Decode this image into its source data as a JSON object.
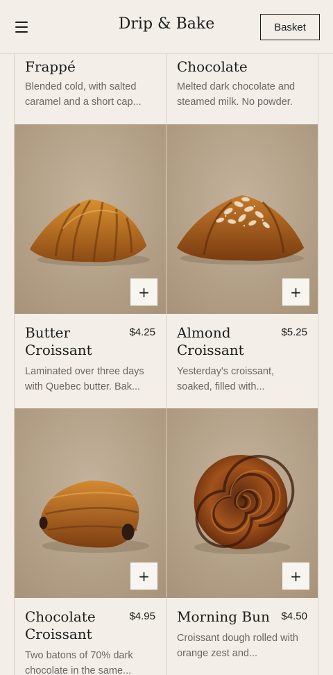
{
  "header": {
    "brand": "Drip & Bake",
    "basket_label": "Basket",
    "menu_icon": "hamburger-menu-icon"
  },
  "products": [
    {
      "name": "Frappé",
      "price": "",
      "description": "Blended cold, with salted caramel and a short cap..."
    },
    {
      "name": "Chocolate",
      "price": "",
      "description": "Melted dark chocolate and steamed milk. No powder."
    },
    {
      "name": "Butter Croissant",
      "price": "$4.25",
      "description": "Laminated over three days with Quebec butter. Bak...",
      "add_label": "+"
    },
    {
      "name": "Almond Croissant",
      "price": "$5.25",
      "description": "Yesterday's croissant, soaked, filled with...",
      "add_label": "+"
    },
    {
      "name": "Chocolate Croissant",
      "price": "$4.95",
      "description": "Two batons of 70% dark chocolate in the same...",
      "add_label": "+"
    },
    {
      "name": "Morning Bun",
      "price": "$4.50",
      "description": "Croissant dough rolled with orange zest and...",
      "add_label": "+"
    }
  ],
  "colors": {
    "background": "#f3efe8",
    "text": "#1b1b1b",
    "muted_text": "#6b6660",
    "divider": "#d7d0c4",
    "photo_backdrop": "#b8a58d"
  }
}
